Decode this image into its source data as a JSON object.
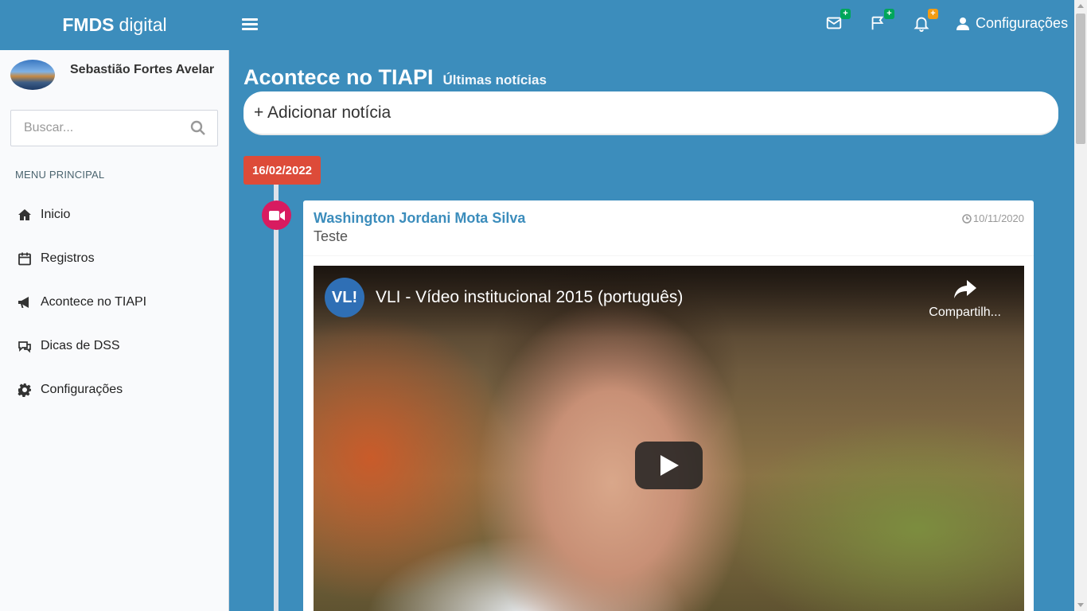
{
  "app": {
    "logo_bold": "FMDS",
    "logo_rest": "digital"
  },
  "header": {
    "badges": {
      "mail": "+",
      "flag": "+",
      "bell": "+"
    },
    "config_label": "Configurações"
  },
  "sidebar": {
    "user_name": "Sebastião Fortes Avelar",
    "search_placeholder": "Buscar...",
    "menu_header": "MENU PRINCIPAL",
    "items": [
      {
        "label": "Inicio",
        "icon": "home-icon"
      },
      {
        "label": "Registros",
        "icon": "calendar-icon"
      },
      {
        "label": "Acontece no TIAPI",
        "icon": "bullhorn-icon"
      },
      {
        "label": "Dicas de DSS",
        "icon": "comments-icon"
      },
      {
        "label": "Configurações",
        "icon": "gear-icon"
      }
    ]
  },
  "content": {
    "title": "Acontece no TIAPI",
    "subtitle": "Últimas notícias",
    "add_news": "+ Adicionar notícia",
    "date_label": "16/02/2022",
    "post": {
      "author": "Washington Jordani Mota Silva",
      "text": "Teste",
      "time": "10/11/2020",
      "video": {
        "logo_text": "VL!",
        "title": "VLI - Vídeo institucional 2015 (português)",
        "share_label": "Compartilh..."
      }
    }
  },
  "colors": {
    "primary": "#3c8dbc",
    "date_label": "#dd4b39",
    "timeline_icon": "#d81b60",
    "badge_green": "#00a65a",
    "badge_orange": "#f39c12"
  }
}
